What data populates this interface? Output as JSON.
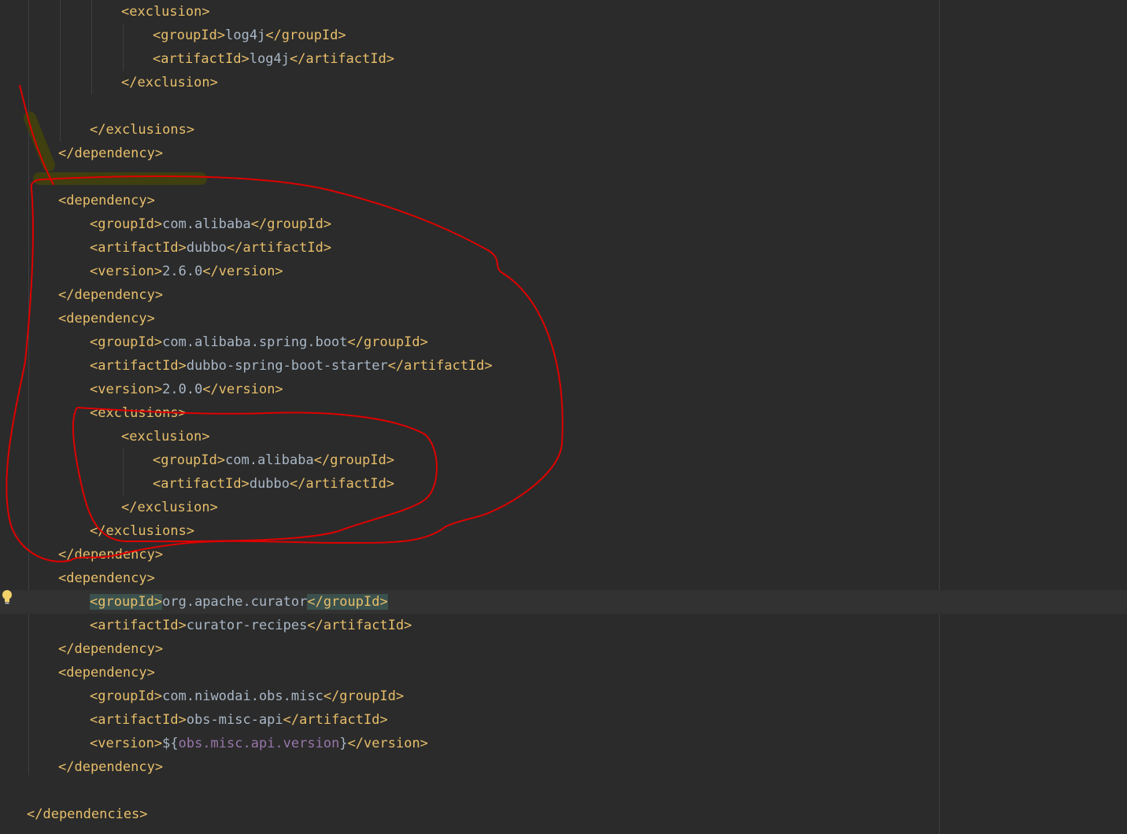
{
  "editor": {
    "lines": [
      {
        "indent": 4,
        "parts": [
          {
            "t": "<exclusion>",
            "c": "tag"
          }
        ]
      },
      {
        "indent": 5,
        "parts": [
          {
            "t": "<groupId>",
            "c": "tag"
          },
          {
            "t": "log4j",
            "c": "txt"
          },
          {
            "t": "</groupId>",
            "c": "tag"
          }
        ]
      },
      {
        "indent": 5,
        "parts": [
          {
            "t": "<artifactId>",
            "c": "tag"
          },
          {
            "t": "log4j",
            "c": "txt"
          },
          {
            "t": "</artifactId>",
            "c": "tag"
          }
        ]
      },
      {
        "indent": 4,
        "parts": [
          {
            "t": "</exclusion>",
            "c": "tag"
          }
        ]
      },
      {
        "indent": 0,
        "parts": []
      },
      {
        "indent": 3,
        "parts": [
          {
            "t": "</exclusions>",
            "c": "tag"
          }
        ]
      },
      {
        "indent": 2,
        "parts": [
          {
            "t": "</dependency>",
            "c": "tag"
          }
        ]
      },
      {
        "indent": 0,
        "parts": []
      },
      {
        "indent": 2,
        "parts": [
          {
            "t": "<dependency>",
            "c": "tag"
          }
        ]
      },
      {
        "indent": 3,
        "parts": [
          {
            "t": "<groupId>",
            "c": "tag"
          },
          {
            "t": "com.alibaba",
            "c": "txt"
          },
          {
            "t": "</groupId>",
            "c": "tag"
          }
        ]
      },
      {
        "indent": 3,
        "parts": [
          {
            "t": "<artifactId>",
            "c": "tag"
          },
          {
            "t": "dubbo",
            "c": "txt"
          },
          {
            "t": "</artifactId>",
            "c": "tag"
          }
        ]
      },
      {
        "indent": 3,
        "parts": [
          {
            "t": "<version>",
            "c": "tag"
          },
          {
            "t": "2.6.0",
            "c": "txt"
          },
          {
            "t": "</version>",
            "c": "tag"
          }
        ]
      },
      {
        "indent": 2,
        "parts": [
          {
            "t": "</dependency>",
            "c": "tag"
          }
        ]
      },
      {
        "indent": 2,
        "parts": [
          {
            "t": "<dependency>",
            "c": "tag"
          }
        ]
      },
      {
        "indent": 3,
        "parts": [
          {
            "t": "<groupId>",
            "c": "tag"
          },
          {
            "t": "com.alibaba.spring.boot",
            "c": "txt"
          },
          {
            "t": "</groupId>",
            "c": "tag"
          }
        ]
      },
      {
        "indent": 3,
        "parts": [
          {
            "t": "<artifactId>",
            "c": "tag"
          },
          {
            "t": "dubbo-spring-boot-starter",
            "c": "txt"
          },
          {
            "t": "</artifactId>",
            "c": "tag"
          }
        ]
      },
      {
        "indent": 3,
        "parts": [
          {
            "t": "<version>",
            "c": "tag"
          },
          {
            "t": "2.0.0",
            "c": "txt"
          },
          {
            "t": "</version>",
            "c": "tag"
          }
        ]
      },
      {
        "indent": 3,
        "parts": [
          {
            "t": "<exclusions>",
            "c": "tag"
          }
        ]
      },
      {
        "indent": 4,
        "parts": [
          {
            "t": "<exclusion>",
            "c": "tag"
          }
        ]
      },
      {
        "indent": 5,
        "parts": [
          {
            "t": "<groupId>",
            "c": "tag"
          },
          {
            "t": "com.alibaba",
            "c": "txt"
          },
          {
            "t": "</groupId>",
            "c": "tag"
          }
        ]
      },
      {
        "indent": 5,
        "parts": [
          {
            "t": "<artifactId>",
            "c": "tag"
          },
          {
            "t": "dubbo",
            "c": "txt"
          },
          {
            "t": "</artifactId>",
            "c": "tag"
          }
        ]
      },
      {
        "indent": 4,
        "parts": [
          {
            "t": "</exclusion>",
            "c": "tag"
          }
        ]
      },
      {
        "indent": 3,
        "parts": [
          {
            "t": "</exclusions>",
            "c": "tag"
          }
        ]
      },
      {
        "indent": 2,
        "parts": [
          {
            "t": "</dependency>",
            "c": "tag"
          }
        ]
      },
      {
        "indent": 2,
        "parts": [
          {
            "t": "<dependency>",
            "c": "tag"
          }
        ]
      },
      {
        "indent": 3,
        "current": true,
        "parts": [
          {
            "t": "<groupId>",
            "c": "tag hl"
          },
          {
            "t": "org.apache.curator",
            "c": "txt"
          },
          {
            "t": "</groupId>",
            "c": "tag hl"
          }
        ]
      },
      {
        "indent": 3,
        "parts": [
          {
            "t": "<artifactId>",
            "c": "tag"
          },
          {
            "t": "curator-recipes",
            "c": "txt"
          },
          {
            "t": "</artifactId>",
            "c": "tag"
          }
        ]
      },
      {
        "indent": 2,
        "parts": [
          {
            "t": "</dependency>",
            "c": "tag"
          }
        ]
      },
      {
        "indent": 2,
        "parts": [
          {
            "t": "<dependency>",
            "c": "tag"
          }
        ]
      },
      {
        "indent": 3,
        "parts": [
          {
            "t": "<groupId>",
            "c": "tag"
          },
          {
            "t": "com.niwodai.obs.misc",
            "c": "txt"
          },
          {
            "t": "</groupId>",
            "c": "tag"
          }
        ]
      },
      {
        "indent": 3,
        "parts": [
          {
            "t": "<artifactId>",
            "c": "tag"
          },
          {
            "t": "obs-misc-api",
            "c": "txt"
          },
          {
            "t": "</artifactId>",
            "c": "tag"
          }
        ]
      },
      {
        "indent": 3,
        "parts": [
          {
            "t": "<version>",
            "c": "tag"
          },
          {
            "t": "${",
            "c": "txt"
          },
          {
            "t": "obs.misc.api.version",
            "c": "prop"
          },
          {
            "t": "}",
            "c": "txt"
          },
          {
            "t": "</version>",
            "c": "tag"
          }
        ]
      },
      {
        "indent": 2,
        "parts": [
          {
            "t": "</dependency>",
            "c": "tag"
          }
        ]
      },
      {
        "indent": 0,
        "parts": []
      },
      {
        "indent": 1,
        "parts": [
          {
            "t": "</dependencies>",
            "c": "tag"
          }
        ]
      }
    ]
  },
  "gutter": {
    "intention_icon": "lightbulb-icon",
    "bulb_color": "#f3d26b"
  },
  "annotation": {
    "stroke_color": "#e00000",
    "mark_color": "#3f3f10"
  }
}
